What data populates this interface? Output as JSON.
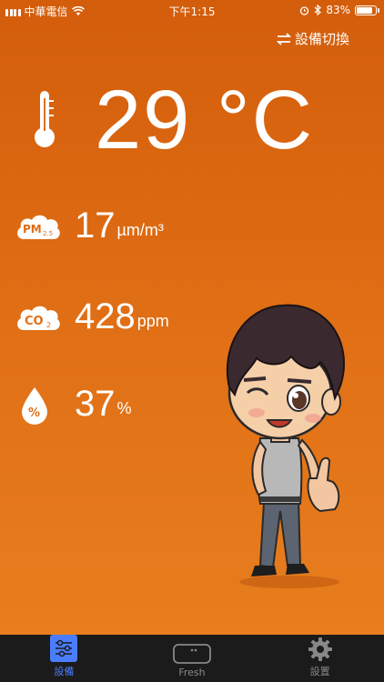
{
  "status_bar": {
    "carrier": "中華電信",
    "time": "下午1:15",
    "battery_percent": "83%",
    "battery_level": 0.83
  },
  "header": {
    "switch_device_label": "設備切換"
  },
  "temperature": {
    "value": "29 °C"
  },
  "metrics": {
    "pm25": {
      "icon_text": "PM",
      "icon_sub": "2.5",
      "value": "17",
      "unit": "µm/m³"
    },
    "co2": {
      "icon_text": "CO",
      "icon_sub": "2",
      "value": "428",
      "unit": "ppm"
    },
    "humidity": {
      "icon_text": "%",
      "value": "37",
      "unit": "%"
    }
  },
  "tabs": [
    {
      "label": "設備",
      "icon": "sliders-icon",
      "active": true
    },
    {
      "label": "Fresh",
      "icon": "device-icon",
      "active": false
    },
    {
      "label": "設置",
      "icon": "gear-icon",
      "active": false
    }
  ],
  "colors": {
    "background_top": "#d35d0b",
    "background_bottom": "#e9801f",
    "tab_active": "#4a7dff",
    "tab_bar": "#1b1b1b"
  }
}
